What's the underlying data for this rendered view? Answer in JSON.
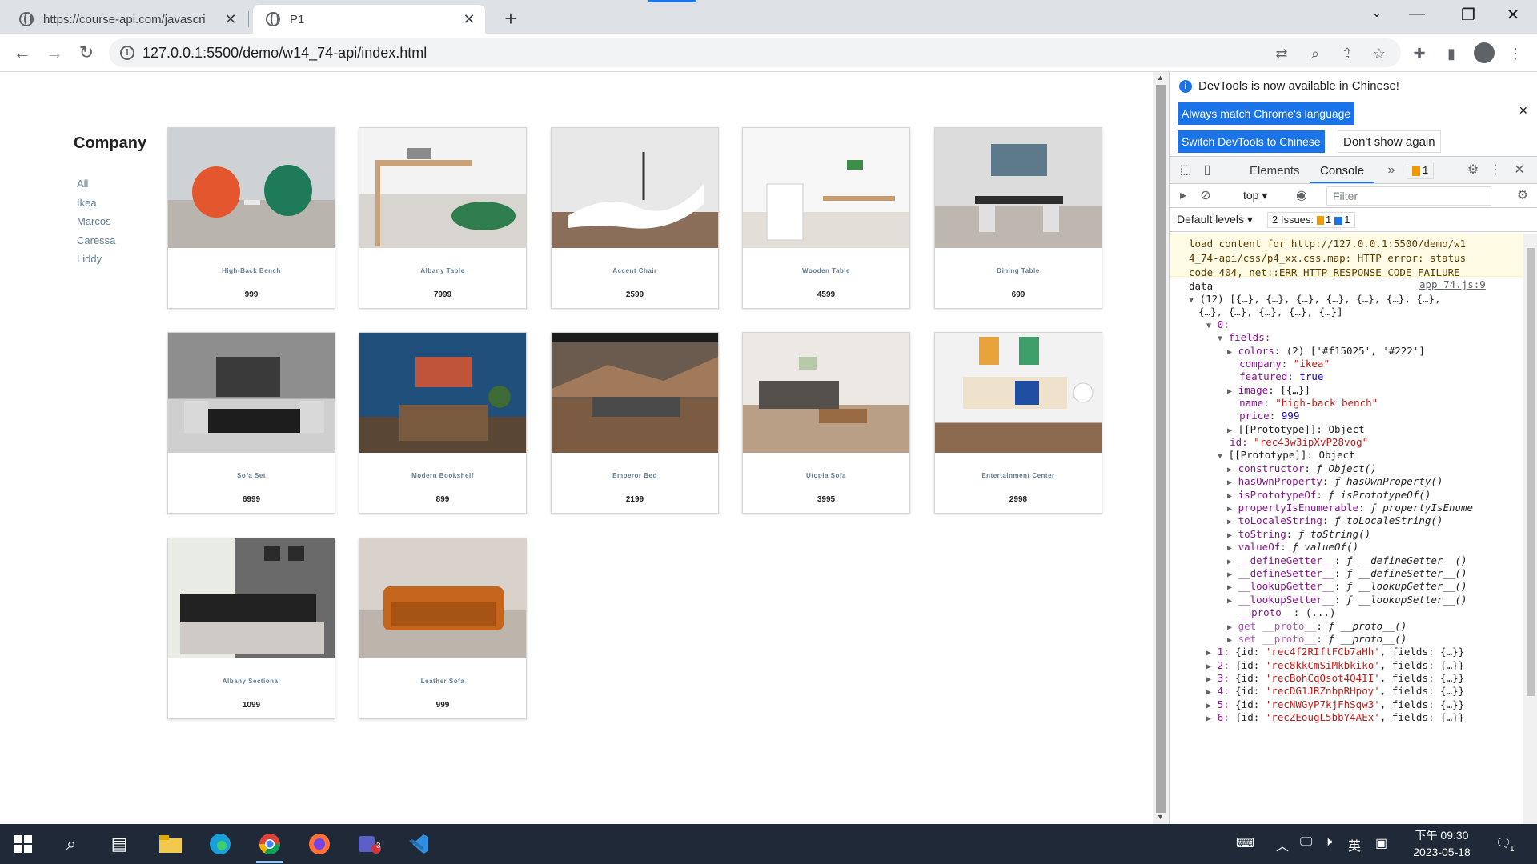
{
  "browser": {
    "tabs": [
      {
        "title": "https://course-api.com/javascri"
      },
      {
        "title": "P1"
      }
    ],
    "url": "127.0.0.1:5500/demo/w14_74-api/index.html"
  },
  "page": {
    "company_heading": "Company",
    "companies": [
      "All",
      "Ikea",
      "Marcos",
      "Caressa",
      "Liddy"
    ],
    "products": [
      {
        "name": "High-Back Bench",
        "price": "999"
      },
      {
        "name": "Albany Table",
        "price": "7999"
      },
      {
        "name": "Accent Chair",
        "price": "2599"
      },
      {
        "name": "Wooden Table",
        "price": "4599"
      },
      {
        "name": "Dining Table",
        "price": "699"
      },
      {
        "name": "Sofa Set",
        "price": "6999"
      },
      {
        "name": "Modern Bookshelf",
        "price": "899"
      },
      {
        "name": "Emperor Bed",
        "price": "2199"
      },
      {
        "name": "Utopia Sofa",
        "price": "3995"
      },
      {
        "name": "Entertainment Center",
        "price": "2998"
      },
      {
        "name": "Albany Sectional",
        "price": "1099"
      },
      {
        "name": "Leather Sofa",
        "price": "999"
      }
    ]
  },
  "devtools": {
    "banner_message": "DevTools is now available in Chinese!",
    "btn_match": "Always match Chrome's language",
    "btn_switch": "Switch DevTools to Chinese",
    "btn_dont_show": "Don't show again",
    "tabs": [
      "Elements",
      "Console"
    ],
    "warn_count": "1",
    "context": "top",
    "filter_placeholder": "Filter",
    "default_levels": "Default levels",
    "issues_label": "2 Issues:",
    "issues_warn": "1",
    "issues_info": "1",
    "warning_lines": [
      "load content for http://127.0.0.1:5500/demo/w1",
      "4_74-api/css/p4_xx.css.map: HTTP error: status",
      "code 404, net::ERR_HTTP_RESPONSE_CODE_FAILURE"
    ],
    "log_label": "data",
    "log_source": "app_74.js:9",
    "array_summary_1": "(12) [{…}, {…}, {…}, {…}, {…}, {…}, {…},",
    "array_summary_2": "{…}, {…}, {…}, {…}, {…}]",
    "item0": "0:",
    "fields_key": "fields:",
    "field_rows": [
      {
        "key": "colors",
        "val": "(2) ['#f15025', '#222']"
      },
      {
        "key": "company",
        "val": "\"ikea\""
      },
      {
        "key": "featured",
        "val": "true"
      },
      {
        "key": "image",
        "val": "[{…}]"
      },
      {
        "key": "name",
        "val": "\"high-back bench\""
      },
      {
        "key": "price",
        "val": "999"
      },
      {
        "key": "[[Prototype]]",
        "val": "Object"
      }
    ],
    "id_key": "id:",
    "id_val": "\"rec43w3ipXvP28vog\"",
    "proto_label": "[[Prototype]]: Object",
    "proto_rows": [
      {
        "key": "constructor",
        "val": "ƒ Object()"
      },
      {
        "key": "hasOwnProperty",
        "val": "ƒ hasOwnProperty()"
      },
      {
        "key": "isPrototypeOf",
        "val": "ƒ isPrototypeOf()"
      },
      {
        "key": "propertyIsEnumerable",
        "val": "ƒ propertyIsEnume"
      },
      {
        "key": "toLocaleString",
        "val": "ƒ toLocaleString()"
      },
      {
        "key": "toString",
        "val": "ƒ toString()"
      },
      {
        "key": "valueOf",
        "val": "ƒ valueOf()"
      },
      {
        "key": "__defineGetter__",
        "val": "ƒ __defineGetter__()"
      },
      {
        "key": "__defineSetter__",
        "val": "ƒ __defineSetter__()"
      },
      {
        "key": "__lookupGetter__",
        "val": "ƒ __lookupGetter__()"
      },
      {
        "key": "__lookupSetter__",
        "val": "ƒ __lookupSetter__()"
      },
      {
        "key": "__proto__",
        "val": "(...)"
      },
      {
        "key": "get __proto__",
        "val": "ƒ __proto__()"
      },
      {
        "key": "set __proto__",
        "val": "ƒ __proto__()"
      }
    ],
    "items": [
      {
        "idx": "1:",
        "id": "'rec4f2RIftFCb7aHh'"
      },
      {
        "idx": "2:",
        "id": "'rec8kkCmSiMkbkiko'"
      },
      {
        "idx": "3:",
        "id": "'recBohCqQsot4Q4II'"
      },
      {
        "idx": "4:",
        "id": "'recDG1JRZnbpRHpoy'"
      },
      {
        "idx": "5:",
        "id": "'recNWGyP7kjFhSqw3'"
      },
      {
        "idx": "6:",
        "id": "'recZEougL5bbY4AEx'"
      }
    ]
  },
  "taskbar": {
    "ime": "英",
    "time": "下午 09:30",
    "date": "2023-05-18",
    "teams_badge": "3",
    "notif_badge": "1"
  }
}
